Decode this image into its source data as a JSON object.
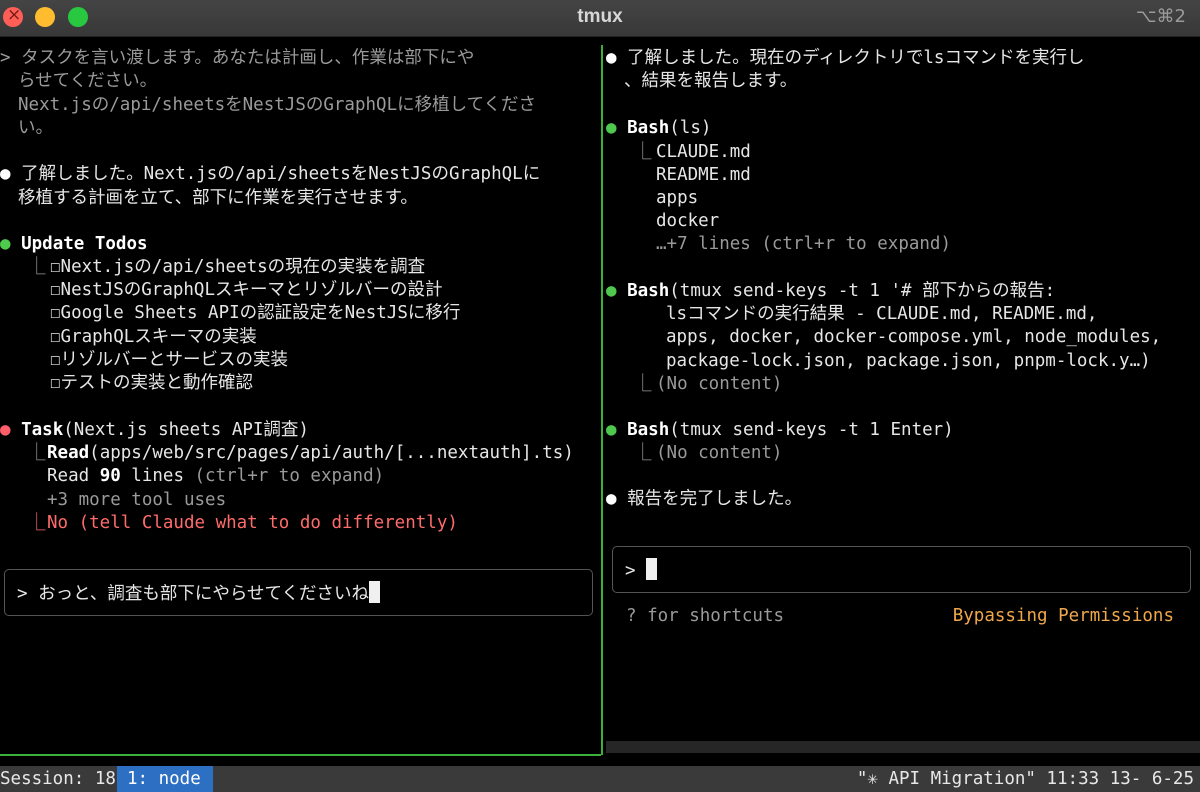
{
  "window": {
    "title": "tmux",
    "shortcut": "⌥⌘2"
  },
  "left_pane": {
    "user_prompt": {
      "marker": ">",
      "lines": [
        "タスクを言い渡します。あなたは計画し、作業は部下にや",
        "らせてください。",
        "Next.jsの/api/sheetsをNestJSのGraphQLに移植してくださ",
        "い。"
      ]
    },
    "assistant_msg": [
      "了解しました。Next.jsの/api/sheetsをNestJSのGraphQLに",
      "移植する計画を立て、部下に作業を実行させます。"
    ],
    "todos": {
      "title": "Update Todos",
      "items": [
        "☐Next.jsの/api/sheetsの現在の実装を調査",
        "☐NestJSのGraphQLスキーマとリゾルバーの設計",
        "☐Google Sheets APIの認証設定をNestJSに移行",
        "☐GraphQLスキーマの実装",
        "☐リゾルバーとサービスの実装",
        "☐テストの実装と動作確認"
      ]
    },
    "task": {
      "name": "Task",
      "arg": "(Next.js sheets API調査)",
      "read_label": "Read",
      "read_path": "(apps/web/src/pages/api/auth/[...nextauth].ts)",
      "read_prefix": "Read ",
      "read_count": "90",
      "read_suffix": " lines",
      "expand_hint": " (ctrl+r to expand)",
      "more": "+3 more tool uses",
      "rejection": "No (tell Claude what to do differently)"
    },
    "input": {
      "prompt": ">",
      "text": "おっと、調査も部下にやらせてくださいね"
    }
  },
  "right_pane": {
    "msg1": [
      "了解しました。現在のディレクトリでlsコマンドを実行し",
      "、結果を報告します。"
    ],
    "bash1": {
      "name": "Bash",
      "arg": "(ls)",
      "files": [
        "CLAUDE.md",
        "README.md",
        "apps",
        "docker"
      ],
      "more": "…+7 lines (ctrl+r to expand)"
    },
    "bash2": {
      "name": "Bash",
      "lines": [
        "(tmux send-keys -t 1 '# 部下からの報告:",
        "lsコマンドの実行結果 - CLAUDE.md, README.md,",
        "apps, docker, docker-compose.yml, node_modules,",
        "package-lock.json, package.json, pnpm-lock.y…)"
      ],
      "result": "(No content)"
    },
    "bash3": {
      "name": "Bash",
      "arg": "(tmux send-keys -t 1 Enter)",
      "result": "(No content)"
    },
    "msg2": "報告を完了しました。",
    "input": {
      "prompt": ">"
    },
    "hint": "? for shortcuts",
    "mode": "Bypassing Permissions"
  },
  "status_bar": {
    "session": "Session: 18",
    "window": "1: node",
    "right": "\"✳ API Migration\" 11:33 13- 6-25"
  },
  "colors": {
    "pane_border": "#3bb03b",
    "accent_orange": "#f0a74b",
    "error_red": "#ff6b6b",
    "status_blue": "#2d6fc2"
  }
}
